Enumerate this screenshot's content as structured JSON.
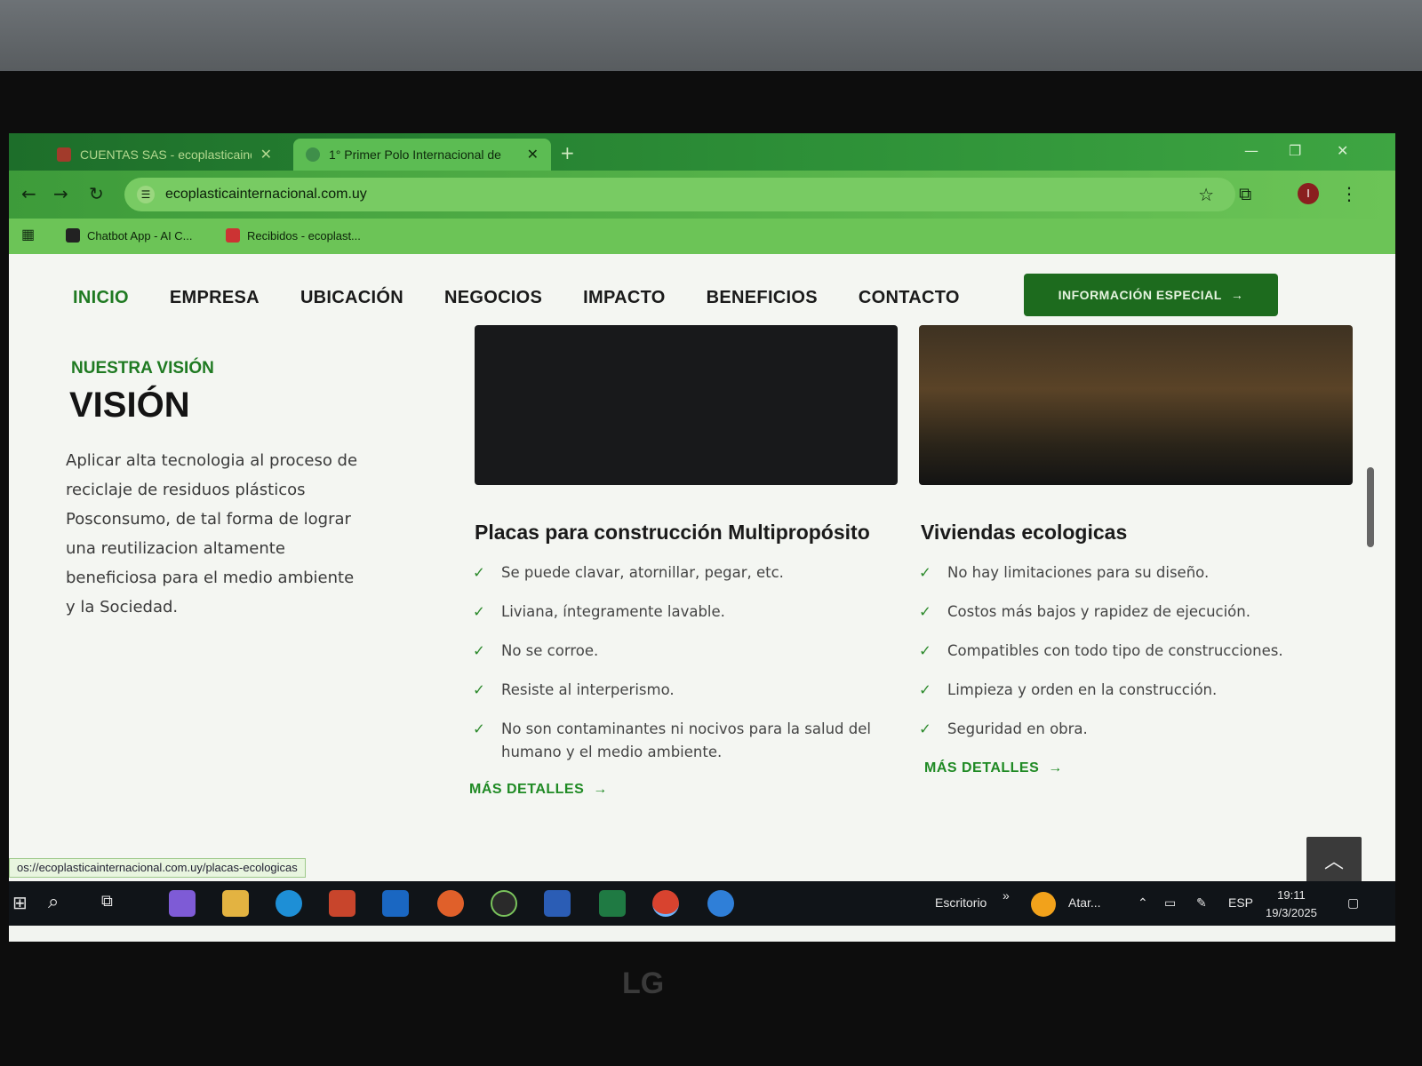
{
  "browser": {
    "tabs": [
      {
        "title": "CUENTAS SAS - ecoplasticaind...",
        "active": false
      },
      {
        "title": "1° Primer Polo Internacional de",
        "active": true
      }
    ],
    "url": "ecoplasticainternacional.com.uy",
    "bookmarks": [
      "Chatbot App - AI C...",
      "Recibidos - ecoplast..."
    ],
    "profile_initial": "I"
  },
  "nav": {
    "items": [
      "INICIO",
      "EMPRESA",
      "UBICACIÓN",
      "NEGOCIOS",
      "IMPACTO",
      "BENEFICIOS",
      "CONTACTO"
    ],
    "active": "INICIO",
    "cta": "INFORMACIÓN ESPECIAL"
  },
  "vision": {
    "eyebrow": "NUESTRA VISIÓN",
    "title": "VISIÓN",
    "text": "Aplicar alta tecnologia al proceso de reciclaje de residuos plásticos Posconsumo, de tal forma de lograr una reutilizacion altamente beneficiosa para el medio ambiente y la Sociedad."
  },
  "cards": [
    {
      "title": "Placas para construcción Multipropósito",
      "bullets": [
        "Se puede clavar, atornillar, pegar, etc.",
        "Liviana, íntegramente lavable.",
        "No se corroe.",
        "Resiste al interperismo.",
        "No son contaminantes ni nocivos para la salud del humano y el medio ambiente."
      ],
      "link": "MÁS DETALLES"
    },
    {
      "title": "Viviendas ecologicas",
      "bullets": [
        "No hay limitaciones para su diseño.",
        "Costos más bajos y rapidez de ejecución.",
        "Compatibles con todo tipo de construcciones.",
        "Limpieza y orden en la construcción.",
        "Seguridad en obra."
      ],
      "link": "MÁS DETALLES"
    }
  ],
  "status_url": "os://ecoplasticainternacional.com.uy/placas-ecologicas",
  "taskbar": {
    "desktop_label": "Escritorio",
    "weather": "Atar...",
    "language": "ESP",
    "time": "19:11",
    "date": "19/3/2025"
  },
  "monitor_brand": "LG",
  "colors": {
    "accent": "#1f7a22",
    "cta_bg": "#1d6b1e",
    "chrome": "#3ea542"
  }
}
